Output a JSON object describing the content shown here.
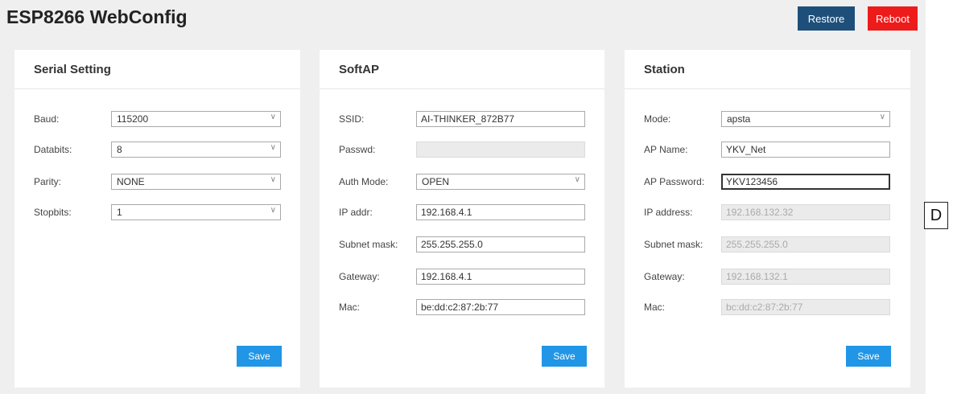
{
  "header": {
    "title": "ESP8266 WebConfig",
    "restore_label": "Restore",
    "reboot_label": "Reboot"
  },
  "serial": {
    "title": "Serial Setting",
    "fields": [
      {
        "label": "Baud:",
        "value": "115200"
      },
      {
        "label": "Databits:",
        "value": "8"
      },
      {
        "label": "Parity:",
        "value": "NONE"
      },
      {
        "label": "Stopbits:",
        "value": "1"
      }
    ],
    "save_label": "Save"
  },
  "softap": {
    "title": "SoftAP",
    "fields": [
      {
        "label": "SSID:",
        "value": "AI-THINKER_872B77"
      },
      {
        "label": "Passwd:",
        "value": ""
      },
      {
        "label": "Auth Mode:",
        "value": "OPEN"
      },
      {
        "label": "IP addr:",
        "value": "192.168.4.1"
      },
      {
        "label": "Subnet mask:",
        "value": "255.255.255.0"
      },
      {
        "label": "Gateway:",
        "value": "192.168.4.1"
      },
      {
        "label": "Mac:",
        "value": "be:dd:c2:87:2b:77"
      }
    ],
    "save_label": "Save"
  },
  "station": {
    "title": "Station",
    "fields": [
      {
        "label": "Mode:",
        "value": "apsta"
      },
      {
        "label": "AP Name:",
        "value": "YKV_Net"
      },
      {
        "label": "AP Password:",
        "value": "YKV123456"
      },
      {
        "label": "IP address:",
        "value": "192.168.132.32"
      },
      {
        "label": "Subnet mask:",
        "value": "255.255.255.0"
      },
      {
        "label": "Gateway:",
        "value": "192.168.132.1"
      },
      {
        "label": "Mac:",
        "value": "bc:dd:c2:87:2b:77"
      }
    ],
    "save_label": "Save"
  },
  "figure_label": "D",
  "colors": {
    "restore": "#1d4f7a",
    "reboot": "#ee1b1b",
    "save": "#2196e6",
    "background": "#efefef"
  }
}
